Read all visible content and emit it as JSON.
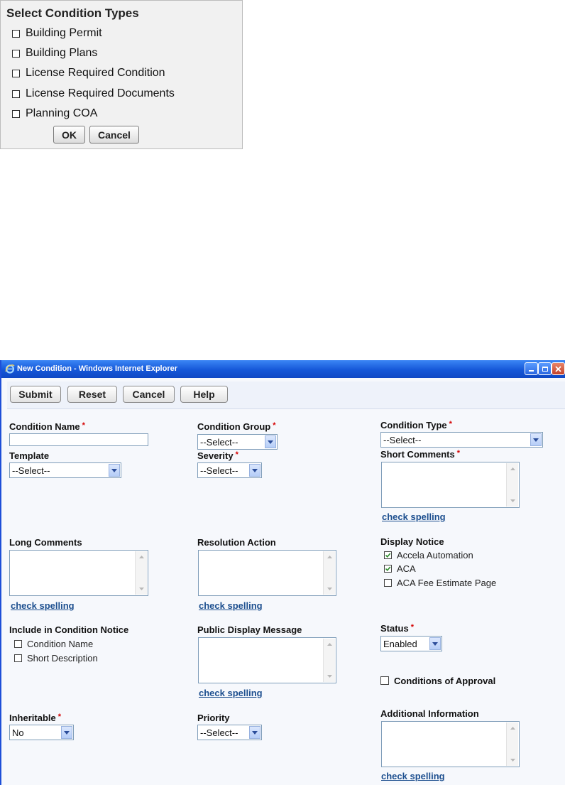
{
  "select_dialog": {
    "title": "Select Condition Types",
    "items": [
      {
        "label": "Building Permit",
        "checked": false
      },
      {
        "label": "Building Plans",
        "checked": false
      },
      {
        "label": "License Required Condition",
        "checked": false
      },
      {
        "label": "License Required Documents",
        "checked": false
      },
      {
        "label": "Planning COA",
        "checked": false
      }
    ],
    "ok_label": "OK",
    "cancel_label": "Cancel"
  },
  "window": {
    "title": "New Condition - Windows Internet Explorer"
  },
  "toolbar": {
    "submit_label": "Submit",
    "reset_label": "Reset",
    "cancel_label": "Cancel",
    "help_label": "Help"
  },
  "form": {
    "condition_name": {
      "label": "Condition Name",
      "value": ""
    },
    "condition_group": {
      "label": "Condition Group",
      "value": "--Select--"
    },
    "condition_type": {
      "label": "Condition Type",
      "value": "--Select--"
    },
    "template": {
      "label": "Template",
      "value": "--Select--"
    },
    "severity": {
      "label": "Severity",
      "value": "--Select--"
    },
    "short_comments": {
      "label": "Short Comments",
      "spell": "check spelling"
    },
    "long_comments": {
      "label": "Long Comments",
      "spell": "check spelling"
    },
    "resolution_action": {
      "label": "Resolution Action",
      "spell": "check spelling"
    },
    "display_notice": {
      "label": "Display Notice",
      "options": [
        {
          "label": "Accela Automation",
          "checked": true
        },
        {
          "label": "ACA",
          "checked": true
        },
        {
          "label": "ACA Fee Estimate Page",
          "checked": false
        }
      ]
    },
    "include_notice": {
      "label": "Include in Condition Notice",
      "options": [
        {
          "label": "Condition Name",
          "checked": false
        },
        {
          "label": "Short Description",
          "checked": false
        }
      ]
    },
    "public_display": {
      "label": "Public Display Message",
      "spell": "check spelling"
    },
    "status": {
      "label": "Status",
      "value": "Enabled"
    },
    "conditions_of_approval": {
      "label": "Conditions of Approval",
      "checked": false
    },
    "inheritable": {
      "label": "Inheritable",
      "value": "No"
    },
    "priority": {
      "label": "Priority",
      "value": "--Select--"
    },
    "additional_info": {
      "label": "Additional Information",
      "spell": "check spelling"
    },
    "required_mark": "*"
  },
  "colors": {
    "required": "#d40000",
    "link": "#1d4f8f",
    "titlebar": "#1557d8",
    "check": "#2a8a2a"
  }
}
